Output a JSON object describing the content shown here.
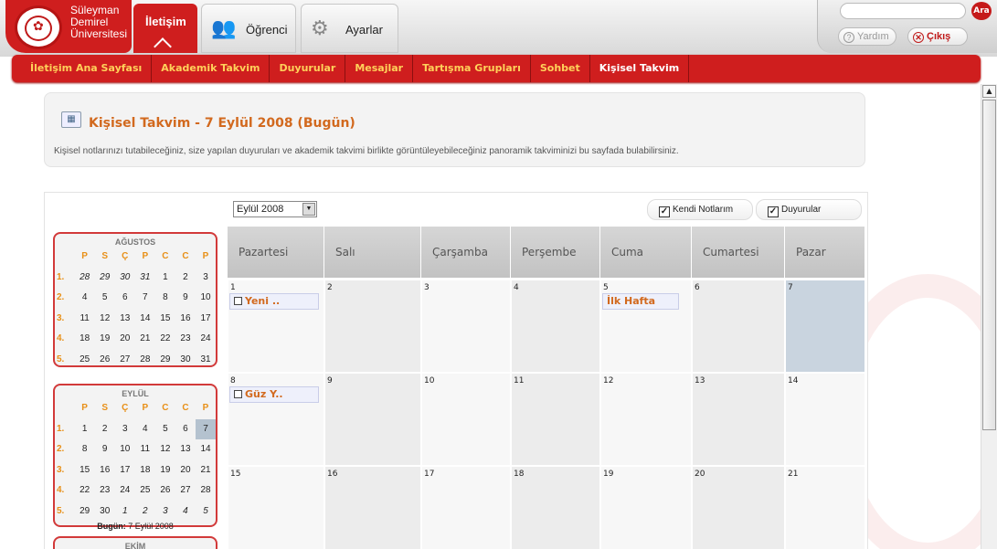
{
  "header": {
    "university_name": [
      "Süleyman",
      "Demirel",
      "Üniversitesi"
    ],
    "tabs": [
      {
        "label": "İletişim",
        "active": true
      },
      {
        "label": "Öğrenci",
        "icon": "users-icon"
      },
      {
        "label": "Ayarlar",
        "icon": "tools-icon"
      }
    ],
    "search_button_label": "Ara",
    "search_placeholder": "",
    "help_label": "Yardım",
    "logout_label": "Çıkış"
  },
  "nav": {
    "items": [
      "İletişim Ana Sayfası",
      "Akademik Takvim",
      "Duyurular",
      "Mesajlar",
      "Tartışma Grupları",
      "Sohbet",
      "Kişisel Takvim"
    ],
    "active_index": 6
  },
  "title_panel": {
    "title": "Kişisel Takvim - 7 Eylül 2008 (Bugün)",
    "description": "Kişisel notlarınızı tutabileceğiniz, size yapılan duyuruları ve akademik takvimi birlikte görüntüleyebileceğiniz panoramik takviminizi bu sayfada bulabilirsiniz."
  },
  "controls": {
    "month_select_value": "Eylül 2008",
    "filter_notes_label": "Kendi Notlarım",
    "filter_notes_checked": true,
    "filter_announcements_label": "Duyurular",
    "filter_announcements_checked": true
  },
  "mini_calendars": {
    "day_headers": [
      "P",
      "S",
      "Ç",
      "P",
      "C",
      "C",
      "P"
    ],
    "august": {
      "title": "AĞUSTOS",
      "weeks": [
        {
          "label": "1.",
          "days": [
            "28",
            "29",
            "30",
            "31",
            "1",
            "2",
            "3"
          ],
          "other": [
            true,
            true,
            true,
            true,
            false,
            false,
            false
          ]
        },
        {
          "label": "2.",
          "days": [
            "4",
            "5",
            "6",
            "7",
            "8",
            "9",
            "10"
          ]
        },
        {
          "label": "3.",
          "days": [
            "11",
            "12",
            "13",
            "14",
            "15",
            "16",
            "17"
          ]
        },
        {
          "label": "4.",
          "days": [
            "18",
            "19",
            "20",
            "21",
            "22",
            "23",
            "24"
          ]
        },
        {
          "label": "5.",
          "days": [
            "25",
            "26",
            "27",
            "28",
            "29",
            "30",
            "31"
          ]
        }
      ]
    },
    "september": {
      "title": "EYLÜL",
      "weeks": [
        {
          "label": "1.",
          "days": [
            "1",
            "2",
            "3",
            "4",
            "5",
            "6",
            "7"
          ],
          "today_index": 6
        },
        {
          "label": "2.",
          "days": [
            "8",
            "9",
            "10",
            "11",
            "12",
            "13",
            "14"
          ]
        },
        {
          "label": "3.",
          "days": [
            "15",
            "16",
            "17",
            "18",
            "19",
            "20",
            "21"
          ]
        },
        {
          "label": "4.",
          "days": [
            "22",
            "23",
            "24",
            "25",
            "26",
            "27",
            "28"
          ]
        },
        {
          "label": "5.",
          "days": [
            "29",
            "30",
            "1",
            "2",
            "3",
            "4",
            "5"
          ],
          "other": [
            false,
            false,
            true,
            true,
            true,
            true,
            true
          ]
        }
      ],
      "today_label": "Bugün:",
      "today_value": "7 Eylül 2008"
    },
    "october": {
      "title": "EKİM"
    }
  },
  "calendar": {
    "weekdays": [
      "Pazartesi",
      "Salı",
      "Çarşamba",
      "Perşembe",
      "Cuma",
      "Cumartesi",
      "Pazar"
    ],
    "weeks": [
      [
        "1",
        "2",
        "3",
        "4",
        "5",
        "6",
        "7"
      ],
      [
        "8",
        "9",
        "10",
        "11",
        "12",
        "13",
        "14"
      ],
      [
        "15",
        "16",
        "17",
        "18",
        "19",
        "20",
        "21"
      ]
    ],
    "today": "7",
    "events": [
      {
        "week": 0,
        "day": 0,
        "text": "Yeni ..",
        "type": "note"
      },
      {
        "week": 0,
        "day": 4,
        "text": "İlk Hafta",
        "type": "announcement"
      },
      {
        "week": 1,
        "day": 0,
        "text": "Güz Y..",
        "type": "note"
      }
    ],
    "colors": {
      "today": "#c9d4df",
      "weekday_bg": "#f7f7f7",
      "alt_bg": "#ececec",
      "event_text": "#d2691e"
    }
  },
  "theme": {
    "accent": "#cf1e1e",
    "nav_text": "#ffd15a",
    "title_color": "#d2691e"
  }
}
